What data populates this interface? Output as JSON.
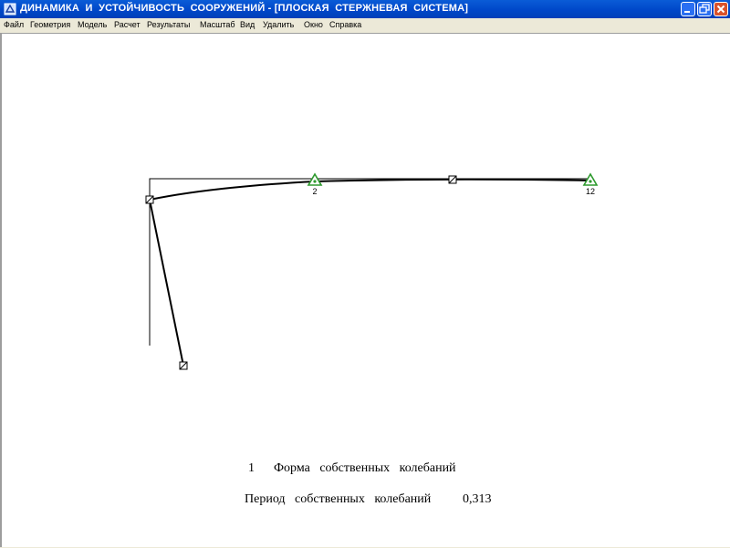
{
  "window": {
    "title": "ДИНАМИКА  И  УСТОЙЧИВОСТЬ  СООРУЖЕНИЙ - [ПЛОСКАЯ  СТЕРЖНЕВАЯ  СИСТЕМА]"
  },
  "menu": {
    "items": [
      "Файл",
      "Геометрия",
      "Модель",
      "Расчет",
      "Результаты",
      "Масштаб",
      "Вид",
      "Удалить",
      "Окно",
      "Справка"
    ]
  },
  "structure": {
    "support_labels": [
      "2",
      "12"
    ],
    "support_color": "#2e9a2e"
  },
  "results": {
    "mode_number": "1",
    "mode_label": "Форма   собственных   колебаний",
    "period_label": "Период   собственных   колебаний",
    "period_value": "0,313"
  }
}
